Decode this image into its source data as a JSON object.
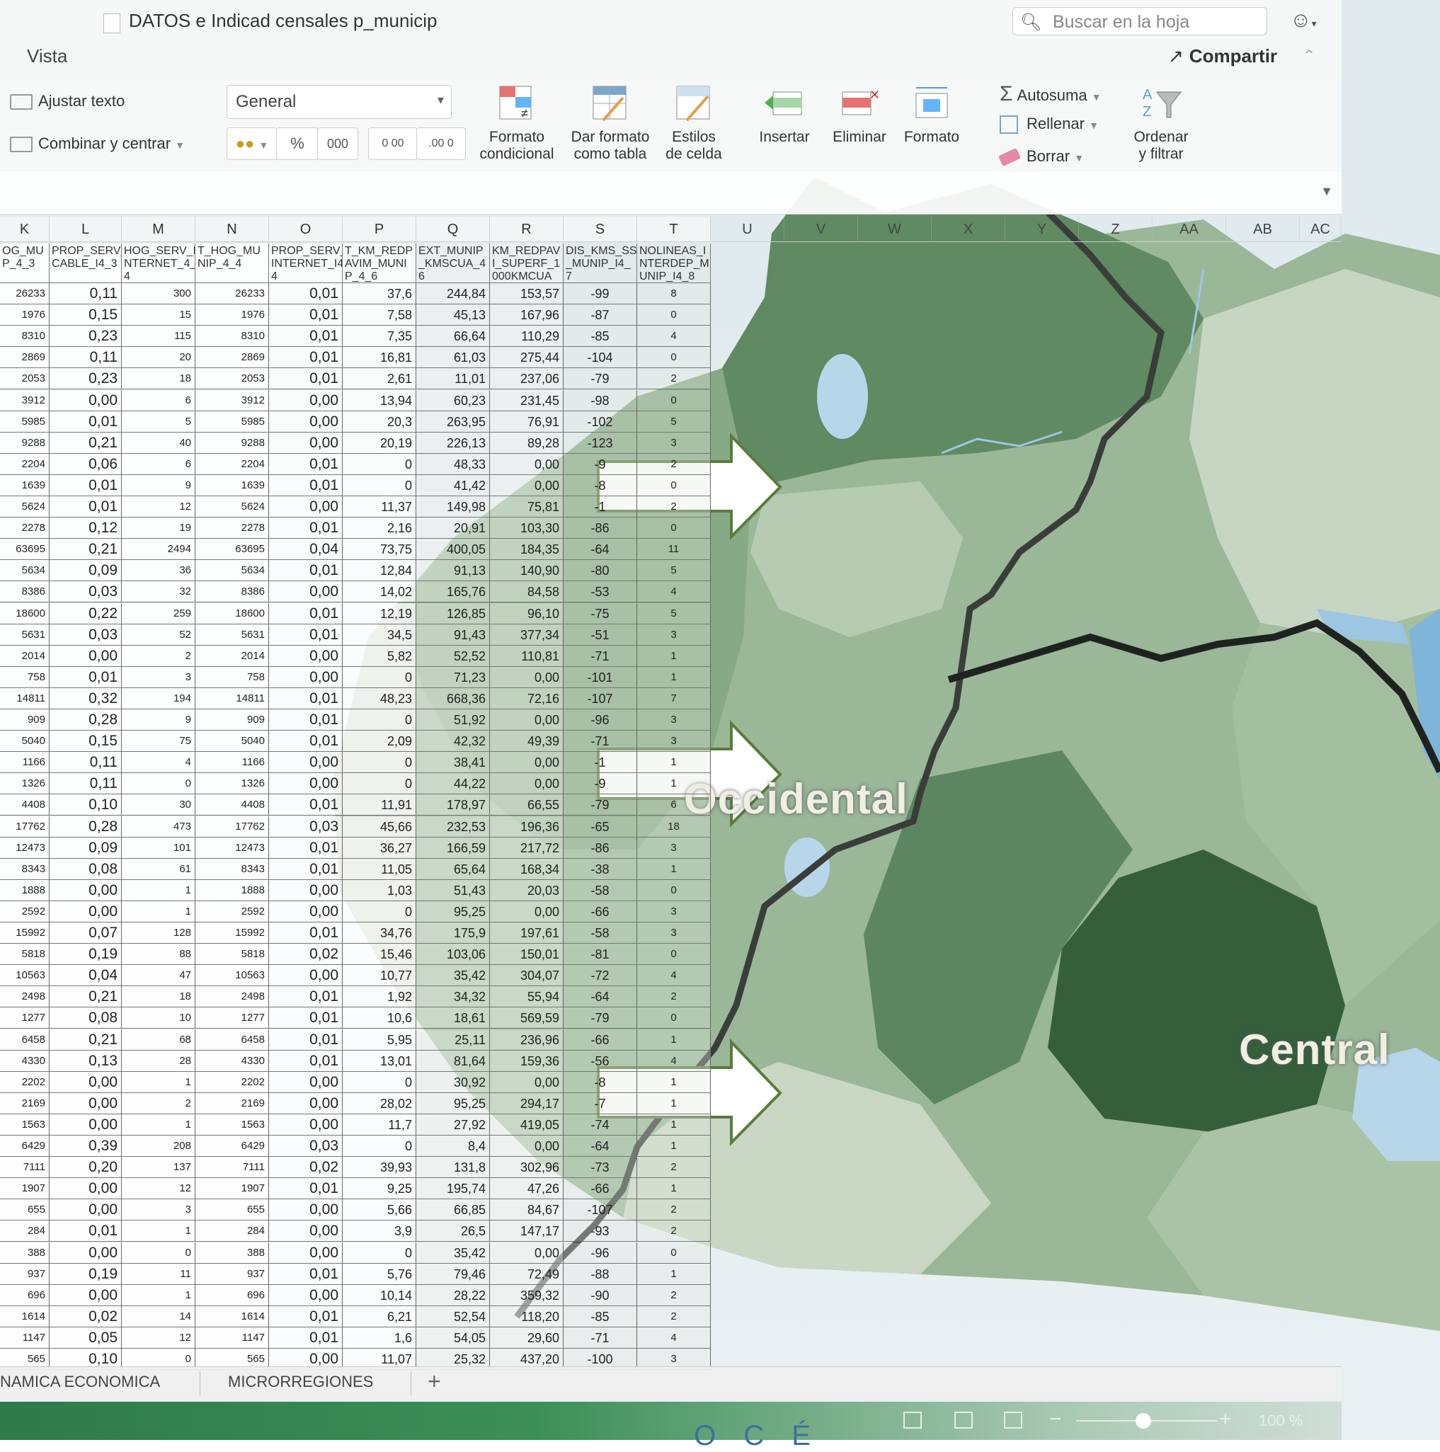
{
  "window": {
    "title": "DATOS e Indicad censales p_municip",
    "search_placeholder": "Buscar en la hoja",
    "menu_vista": "Vista",
    "share_label": "Compartir"
  },
  "ribbon": {
    "wrap_text": "Ajustar texto",
    "merge_center": "Combinar y centrar",
    "number_format": "General",
    "percent": "%",
    "thousands": "000",
    "dec_increase": "0 00",
    "dec_decrease": ".00 0",
    "conditional_1": "Formato",
    "conditional_2": "condicional",
    "table_1": "Dar formato",
    "table_2": "como tabla",
    "styles_1": "Estilos",
    "styles_2": "de celda",
    "insert": "Insertar",
    "delete": "Eliminar",
    "format": "Formato",
    "autosum": "Autosuma",
    "fill": "Rellenar",
    "clear": "Borrar",
    "sort_1": "Ordenar",
    "sort_2": "y filtrar"
  },
  "columns": [
    "K",
    "L",
    "M",
    "N",
    "O",
    "P",
    "Q",
    "R",
    "S",
    "T",
    "U",
    "V",
    "W",
    "X",
    "Y",
    "Z",
    "AA",
    "AB",
    "AC"
  ],
  "field_headers": [
    "OG_MU P_4_3",
    "PROP_SERV_ CABLE_I4_3",
    "HOG_SERV_I NTERNET_4_ 4",
    "T_HOG_MU NIP_4_4",
    "PROP_SERV_ INTERNET_I4 4",
    "T_KM_REDP AVIM_MUNI P_4_6",
    "EXT_MUNIP _KMSCUA_4 6",
    "KM_REDPAV I_SUPERF_1 000KMCUA",
    "DIS_KMS_SS _MUNIP_I4_ 7",
    "NOLINEAS_I NTERDEP_M UNIP_I4_8"
  ],
  "rows": [
    [
      "26233",
      "0,11",
      "300",
      "26233",
      "0,01",
      "37,6",
      "244,84",
      "153,57",
      "-99",
      "8"
    ],
    [
      "1976",
      "0,15",
      "15",
      "1976",
      "0,01",
      "7,58",
      "45,13",
      "167,96",
      "-87",
      "0"
    ],
    [
      "8310",
      "0,23",
      "115",
      "8310",
      "0,01",
      "7,35",
      "66,64",
      "110,29",
      "-85",
      "4"
    ],
    [
      "2869",
      "0,11",
      "20",
      "2869",
      "0,01",
      "16,81",
      "61,03",
      "275,44",
      "-104",
      "0"
    ],
    [
      "2053",
      "0,23",
      "18",
      "2053",
      "0,01",
      "2,61",
      "11,01",
      "237,06",
      "-79",
      "2"
    ],
    [
      "3912",
      "0,00",
      "6",
      "3912",
      "0,00",
      "13,94",
      "60,23",
      "231,45",
      "-98",
      "0"
    ],
    [
      "5985",
      "0,01",
      "5",
      "5985",
      "0,00",
      "20,3",
      "263,95",
      "76,91",
      "-102",
      "5"
    ],
    [
      "9288",
      "0,21",
      "40",
      "9288",
      "0,00",
      "20,19",
      "226,13",
      "89,28",
      "-123",
      "3"
    ],
    [
      "2204",
      "0,06",
      "6",
      "2204",
      "0,01",
      "0",
      "48,33",
      "0,00",
      "-9",
      "2"
    ],
    [
      "1639",
      "0,01",
      "9",
      "1639",
      "0,01",
      "0",
      "41,42",
      "0,00",
      "-8",
      "0"
    ],
    [
      "5624",
      "0,01",
      "12",
      "5624",
      "0,00",
      "11,37",
      "149,98",
      "75,81",
      "-1",
      "2"
    ],
    [
      "2278",
      "0,12",
      "19",
      "2278",
      "0,01",
      "2,16",
      "20,91",
      "103,30",
      "-86",
      "0"
    ],
    [
      "63695",
      "0,21",
      "2494",
      "63695",
      "0,04",
      "73,75",
      "400,05",
      "184,35",
      "-64",
      "11"
    ],
    [
      "5634",
      "0,09",
      "36",
      "5634",
      "0,01",
      "12,84",
      "91,13",
      "140,90",
      "-80",
      "5"
    ],
    [
      "8386",
      "0,03",
      "32",
      "8386",
      "0,00",
      "14,02",
      "165,76",
      "84,58",
      "-53",
      "4"
    ],
    [
      "18600",
      "0,22",
      "259",
      "18600",
      "0,01",
      "12,19",
      "126,85",
      "96,10",
      "-75",
      "5"
    ],
    [
      "5631",
      "0,03",
      "52",
      "5631",
      "0,01",
      "34,5",
      "91,43",
      "377,34",
      "-51",
      "3"
    ],
    [
      "2014",
      "0,00",
      "2",
      "2014",
      "0,00",
      "5,82",
      "52,52",
      "110,81",
      "-71",
      "1"
    ],
    [
      "758",
      "0,01",
      "3",
      "758",
      "0,00",
      "0",
      "71,23",
      "0,00",
      "-101",
      "1"
    ],
    [
      "14811",
      "0,32",
      "194",
      "14811",
      "0,01",
      "48,23",
      "668,36",
      "72,16",
      "-107",
      "7"
    ],
    [
      "909",
      "0,28",
      "9",
      "909",
      "0,01",
      "0",
      "51,92",
      "0,00",
      "-96",
      "3"
    ],
    [
      "5040",
      "0,15",
      "75",
      "5040",
      "0,01",
      "2,09",
      "42,32",
      "49,39",
      "-71",
      "3"
    ],
    [
      "1166",
      "0,11",
      "4",
      "1166",
      "0,00",
      "0",
      "38,41",
      "0,00",
      "-1",
      "1"
    ],
    [
      "1326",
      "0,11",
      "0",
      "1326",
      "0,00",
      "0",
      "44,22",
      "0,00",
      "-9",
      "1"
    ],
    [
      "4408",
      "0,10",
      "30",
      "4408",
      "0,01",
      "11,91",
      "178,97",
      "66,55",
      "-79",
      "6"
    ],
    [
      "17762",
      "0,28",
      "473",
      "17762",
      "0,03",
      "45,66",
      "232,53",
      "196,36",
      "-65",
      "18"
    ],
    [
      "12473",
      "0,09",
      "101",
      "12473",
      "0,01",
      "36,27",
      "166,59",
      "217,72",
      "-86",
      "3"
    ],
    [
      "8343",
      "0,08",
      "61",
      "8343",
      "0,01",
      "11,05",
      "65,64",
      "168,34",
      "-38",
      "1"
    ],
    [
      "1888",
      "0,00",
      "1",
      "1888",
      "0,00",
      "1,03",
      "51,43",
      "20,03",
      "-58",
      "0"
    ],
    [
      "2592",
      "0,00",
      "1",
      "2592",
      "0,00",
      "0",
      "95,25",
      "0,00",
      "-66",
      "3"
    ],
    [
      "15992",
      "0,07",
      "128",
      "15992",
      "0,01",
      "34,76",
      "175,9",
      "197,61",
      "-58",
      "3"
    ],
    [
      "5818",
      "0,19",
      "88",
      "5818",
      "0,02",
      "15,46",
      "103,06",
      "150,01",
      "-81",
      "0"
    ],
    [
      "10563",
      "0,04",
      "47",
      "10563",
      "0,00",
      "10,77",
      "35,42",
      "304,07",
      "-72",
      "4"
    ],
    [
      "2498",
      "0,21",
      "18",
      "2498",
      "0,01",
      "1,92",
      "34,32",
      "55,94",
      "-64",
      "2"
    ],
    [
      "1277",
      "0,08",
      "10",
      "1277",
      "0,01",
      "10,6",
      "18,61",
      "569,59",
      "-79",
      "0"
    ],
    [
      "6458",
      "0,21",
      "68",
      "6458",
      "0,01",
      "5,95",
      "25,11",
      "236,96",
      "-66",
      "1"
    ],
    [
      "4330",
      "0,13",
      "28",
      "4330",
      "0,01",
      "13,01",
      "81,64",
      "159,36",
      "-56",
      "4"
    ],
    [
      "2202",
      "0,00",
      "1",
      "2202",
      "0,00",
      "0",
      "30,92",
      "0,00",
      "-8",
      "1"
    ],
    [
      "2169",
      "0,00",
      "2",
      "2169",
      "0,00",
      "28,02",
      "95,25",
      "294,17",
      "-7",
      "1"
    ],
    [
      "1563",
      "0,00",
      "1",
      "1563",
      "0,00",
      "11,7",
      "27,92",
      "419,05",
      "-74",
      "1"
    ],
    [
      "6429",
      "0,39",
      "208",
      "6429",
      "0,03",
      "0",
      "8,4",
      "0,00",
      "-64",
      "1"
    ],
    [
      "7111",
      "0,20",
      "137",
      "7111",
      "0,02",
      "39,93",
      "131,8",
      "302,96",
      "-73",
      "2"
    ],
    [
      "1907",
      "0,00",
      "12",
      "1907",
      "0,01",
      "9,25",
      "195,74",
      "47,26",
      "-66",
      "1"
    ],
    [
      "655",
      "0,00",
      "3",
      "655",
      "0,00",
      "5,66",
      "66,85",
      "84,67",
      "-107",
      "2"
    ],
    [
      "284",
      "0,01",
      "1",
      "284",
      "0,00",
      "3,9",
      "26,5",
      "147,17",
      "-93",
      "2"
    ],
    [
      "388",
      "0,00",
      "0",
      "388",
      "0,00",
      "0",
      "35,42",
      "0,00",
      "-96",
      "0"
    ],
    [
      "937",
      "0,19",
      "11",
      "937",
      "0,01",
      "5,76",
      "79,46",
      "72,49",
      "-88",
      "1"
    ],
    [
      "696",
      "0,00",
      "1",
      "696",
      "0,00",
      "10,14",
      "28,22",
      "359,32",
      "-90",
      "2"
    ],
    [
      "1614",
      "0,02",
      "14",
      "1614",
      "0,01",
      "6,21",
      "52,54",
      "118,20",
      "-85",
      "2"
    ],
    [
      "1147",
      "0,05",
      "12",
      "1147",
      "0,01",
      "1,6",
      "54,05",
      "29,60",
      "-71",
      "4"
    ],
    [
      "565",
      "0,10",
      "0",
      "565",
      "0,00",
      "11,07",
      "25,32",
      "437,20",
      "-100",
      "3"
    ]
  ],
  "sheets": [
    "NAMICA ECONOMICA",
    "MICRORREGIONES"
  ],
  "add_sheet": "+",
  "zoom": "100 %",
  "map": {
    "labels": [
      "Occidental",
      "Central"
    ],
    "bottom_text": "O C É"
  },
  "colors": {
    "status_green": "#2f7a49",
    "map_dark": "#3f6b45",
    "map_mid": "#7fa27f",
    "map_light": "#b9ccb5",
    "lake": "#b8d6ea",
    "arrow_outline": "#5a7c3c"
  }
}
